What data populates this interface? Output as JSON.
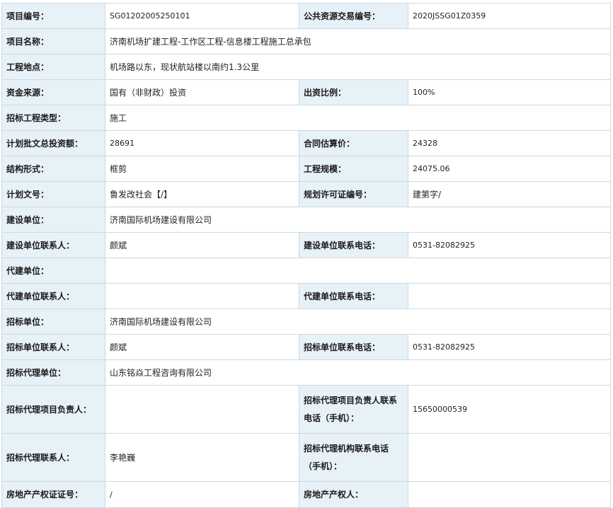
{
  "rows": [
    {
      "l1": "项目编号：",
      "v1": "SG01202005250101",
      "l2": "公共资源交易编号：",
      "v2": "2020JSSG01Z0359"
    },
    {
      "l1": "项目名称：",
      "v1": "济南机场扩建工程-工作区工程-信息楼工程施工总承包"
    },
    {
      "l1": "工程地点：",
      "v1": "机场路以东，现状航站楼以南约1.3公里"
    },
    {
      "l1": "资金来源：",
      "v1": "国有（非财政）投资",
      "l2": "出资比例：",
      "v2": "100%"
    },
    {
      "l1": "招标工程类型：",
      "v1": "施工"
    },
    {
      "l1": "计划批文总投资额：",
      "v1": "28691",
      "l2": "合同估算价：",
      "v2": "24328"
    },
    {
      "l1": "结构形式：",
      "v1": "框剪",
      "l2": "工程规模：",
      "v2": "24075.06"
    },
    {
      "l1": "计划文号：",
      "v1": "鲁发改社会【/】",
      "l2": "规划许可证编号：",
      "v2": "建第字/"
    },
    {
      "l1": "建设单位：",
      "v1": "济南国际机场建设有限公司"
    },
    {
      "l1": "建设单位联系人：",
      "v1": "颜斌",
      "l2": "建设单位联系电话：",
      "v2": "0531-82082925"
    },
    {
      "l1": "代建单位：",
      "v1": ""
    },
    {
      "l1": "代建单位联系人：",
      "v1": "",
      "l2": "代建单位联系电话：",
      "v2": ""
    },
    {
      "l1": "招标单位：",
      "v1": "济南国际机场建设有限公司"
    },
    {
      "l1": "招标单位联系人：",
      "v1": "颜斌",
      "l2": "招标单位联系电话：",
      "v2": "0531-82082925"
    },
    {
      "l1": "招标代理单位：",
      "v1": "山东铭焱工程咨询有限公司"
    },
    {
      "l1": "招标代理项目负责人：",
      "v1": "",
      "l2": "招标代理项目负责人联系电话（手机）：",
      "v2": "15650000539"
    },
    {
      "l1": "招标代理联系人：",
      "v1": "李艳巍",
      "l2": "招标代理机构联系电话（手机）：",
      "v2": ""
    },
    {
      "l1": "房地产产权证证号：",
      "v1": "/",
      "l2": "房地产产权人：",
      "v2": ""
    }
  ]
}
